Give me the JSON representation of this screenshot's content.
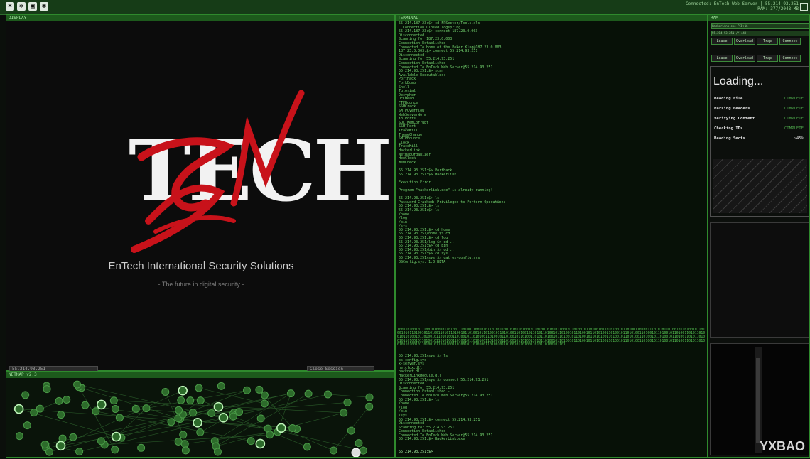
{
  "topbar": {
    "icons": [
      "close-icon",
      "gear-icon",
      "save-icon",
      "settings-icon"
    ],
    "info_line1": "Connected: EnTech Web Server | 55.214.93.251",
    "info_line2": "RAM: 377/2048 MB"
  },
  "logo_panel": {
    "header": "DISPLAY",
    "brand": "TECH",
    "brand_overlay": "EN",
    "company": "EnTech International Security Solutions",
    "tagline": "- The future in digital security -",
    "status_left": "55.214.93.251",
    "status_right": "Close Session"
  },
  "net_panel": {
    "header": "NETMAP v2.3"
  },
  "terminal": {
    "header": "TERMINAL",
    "log_top": "55.214.187.23:$> cd FPSector/Tools.xls\n  Connection Closed logspring\n55.214.187.23:$> connect 187.23.0.003\nDisconnected\nScanning for 187.23.0.003\nConnection Established -\nConnected To Home of the Poker King@187.23.0.003\n187.23.0.003:$> connect 55.214.93.251\nDisconnected\nScanning for 55.214.93.251\nConnection Established -\nConnected To EnTech Web Server@55.214.93.251\n55.214.93.251:$> scan\nAvailable Executables:\nPortHack\nForkBomb\nShell\nTutorial\nDecypher\nDECHead\nFTPBounce\nSSHCrack\nSMTPOverflow\nWebServerWorm\nKBTPorts\nSQL_MemCorrupt\nSSH_Port\nTraceKill\nThemeChanger\nSMTPBounce\nClock\nTraceKill\nHackerLink\nNetMapOrganizer\nHexClock\nMemCheck\n\n55.214.93.251:$> PortHack\n55.214.93.251:$> HackerLink\n\nExecution Error\n\nProgram \"hackerlink.exe\" is already running!\n\n55.214.93.251:$> ls\nPassword Cracked: Privileges to Perform Operations\n55.214.93.251:$> ls\n55.214.93.251:$> ls\n/home\n/log\n/bin\n/sys\n55.214.93.251:$> cd home\n55.214.93.251/home:$> cd ..\n55.214.93.251:$> cd log\n55.214.93.251/log:$> cd ..\n55.214.93.251:$> cd bin\n55.214.93.251/bin:$> cd ..\n55.214.93.251:$> cd sys\n55.214.93.251/sys:$> cat os-config.sys\nOSConfig.sys: 1.0 BETA",
    "hex_block": "1001101001011100101001011010011101001100101011010011001010110100101101001010101100101101001011010010110101001011010011010011101010110100101101001011010010101101001011010011010110100101101001011010010110101001101001011010110100101101001011010010110101001101001011010100110100101101001011010011010110100101101001011010010110101001101001011010100110100101101001011010011010110100101101001011010010110101001101001011010100110100101101001011010011010110100101101001011010010110101001101001011010100110100101101001011010011010110100101101001011010010110101001101001011010100110100101101001011010011010110100101101001011010010110101001101001011010100110100101101001011010011010110100101101",
    "log_bottom": "55.214.93.251/sys:$> ls\nos-config.sys\nx-server.sys\nnetcfgx.dll\nhacknet.dll\nHackerLinkModule.dll\n55.214.93.251/sys:$> connect 55.214.93.251\nDisconnected\nScanning for 55.214.93.251\nConnection Established -\nConnected To EnTech Web Server@55.214.93.251\n55.214.93.251:$> ls\n/home\n/log\n/bin\n/sys\n55.214.93.251:$> connect 55.214.93.251\nDisconnected\nScanning for 55.214.93.251\nConnection Established -\nConnected To EnTech Web Server@55.214.93.251\n55.214.93.251:$> HackerLink.exe",
    "prompt": "55.214.93.251:$> |"
  },
  "right_panel": {
    "header": "RAM",
    "bar1": "HackerLink.exe  PID:16",
    "bar2": "55.214.93.251 // 443",
    "buttons_row1": [
      "Leave",
      "Overload",
      "Trap",
      "Connect"
    ],
    "buttons_row2": [
      "Leave",
      "Overload",
      "Trap",
      "Connect"
    ],
    "loading_title": "Loading...",
    "rows": [
      {
        "label": "Reading File...",
        "value": "COMPLETE"
      },
      {
        "label": "Parsing Headers...",
        "value": "COMPLETE"
      },
      {
        "label": "Verifying Content...",
        "value": "COMPLETE"
      },
      {
        "label": "Checking IDs...",
        "value": "COMPLETE"
      },
      {
        "label": "Reading Sects...",
        "value": "~45%"
      }
    ],
    "watermark": "YXBAO"
  },
  "colors": {
    "accent": "#2f8a2d",
    "text": "#74d56f",
    "brand_red": "#c8121a"
  }
}
